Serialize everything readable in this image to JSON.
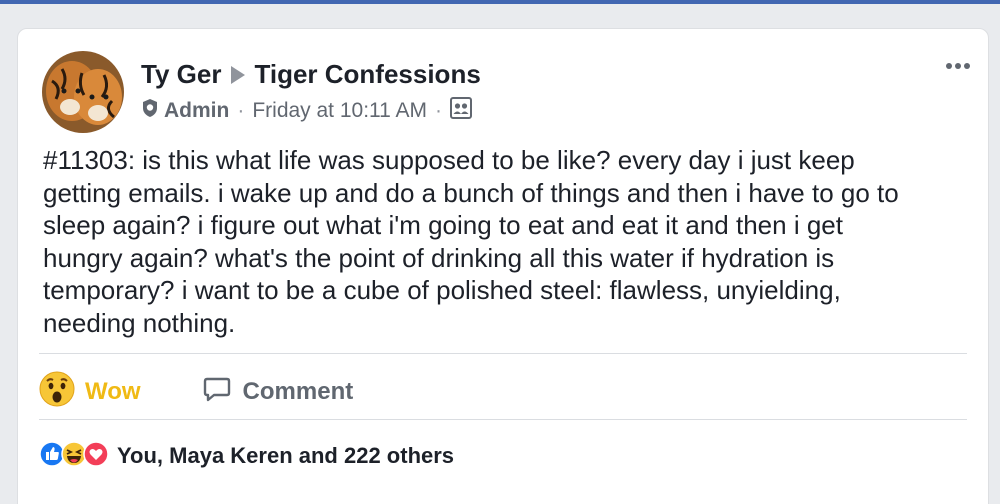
{
  "post": {
    "author": "Ty Ger",
    "group": "Tiger Confessions",
    "role": "Admin",
    "timestamp": "Friday at 10:11 AM",
    "separator": "·",
    "audience_icon": "group-members-icon",
    "text": "#11303: is this what life was supposed to be like? every day i just keep\ngetting emails. i wake up and do a bunch of things and then i have to go to\nsleep again? i figure out what i'm going to eat and eat it and then i get\nhungry again? what's the point of drinking all this water if hydration is\ntemporary? i want to be a cube of polished steel: flawless, unyielding,\nneeding nothing."
  },
  "actions": {
    "reaction_label": "Wow",
    "comment_label": "Comment"
  },
  "reactions": {
    "summary": "You, Maya Keren and 222 others",
    "icons": [
      "like-icon",
      "haha-icon",
      "love-icon"
    ]
  },
  "colors": {
    "wow": "#f0ba15",
    "like": "#1877f2",
    "love": "#f33e58",
    "top_bar": "#4267b2"
  }
}
